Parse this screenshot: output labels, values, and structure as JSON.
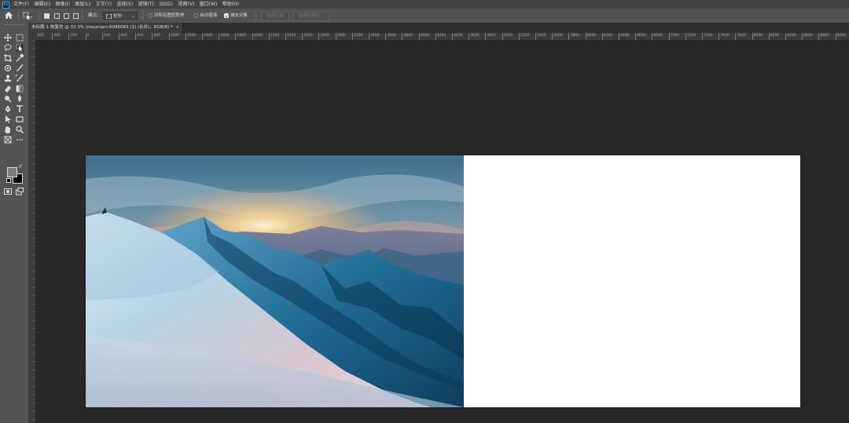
{
  "app": {
    "logo": "Ps"
  },
  "menubar": {
    "items": [
      "文件(F)",
      "编辑(E)",
      "图像(I)",
      "图层(L)",
      "文字(Y)",
      "选择(S)",
      "滤镜(T)",
      "3D(D)",
      "视图(V)",
      "窗口(W)",
      "帮助(H)"
    ]
  },
  "options": {
    "home_icon": "home-icon",
    "mode_label": "模式:",
    "mode_value": "矩形",
    "sample_all_label": "对所有图层取样",
    "sample_all_checked": false,
    "auto_enhance_label": "自动增强",
    "auto_enhance_checked": false,
    "subtract_label": "减去对象",
    "subtract_checked": true,
    "select_subject_label": "选择主体",
    "refine_label": "选择并遮住..."
  },
  "document": {
    "tab_title": "未标题-1-恢复的 @ 33.3% (mountain-6086083 (1) (合并)，RGB/8) *",
    "close_glyph": "×"
  },
  "ruler": {
    "h_labels": [
      "600",
      "400",
      "200",
      "0",
      "200",
      "400",
      "600",
      "800",
      "1000",
      "1200",
      "1400",
      "1600",
      "1800",
      "2000",
      "2200",
      "2400",
      "2600",
      "2800",
      "3000",
      "3200",
      "3400",
      "3600",
      "3800",
      "4000",
      "4200",
      "4400",
      "4600",
      "4800",
      "5000",
      "5200",
      "5400",
      "5600",
      "5800",
      "6000",
      "6200",
      "6400",
      "6600",
      "6800",
      "7000",
      "7200",
      "7400",
      "7600",
      "7800",
      "8000",
      "8200",
      "8400",
      "8600",
      "8800",
      "9000",
      "9200",
      "9400",
      "9600"
    ]
  },
  "colors": {
    "foreground": "#7a7a8a",
    "background": "#000000",
    "canvas": "#ffffff",
    "workspace": "#282828"
  }
}
